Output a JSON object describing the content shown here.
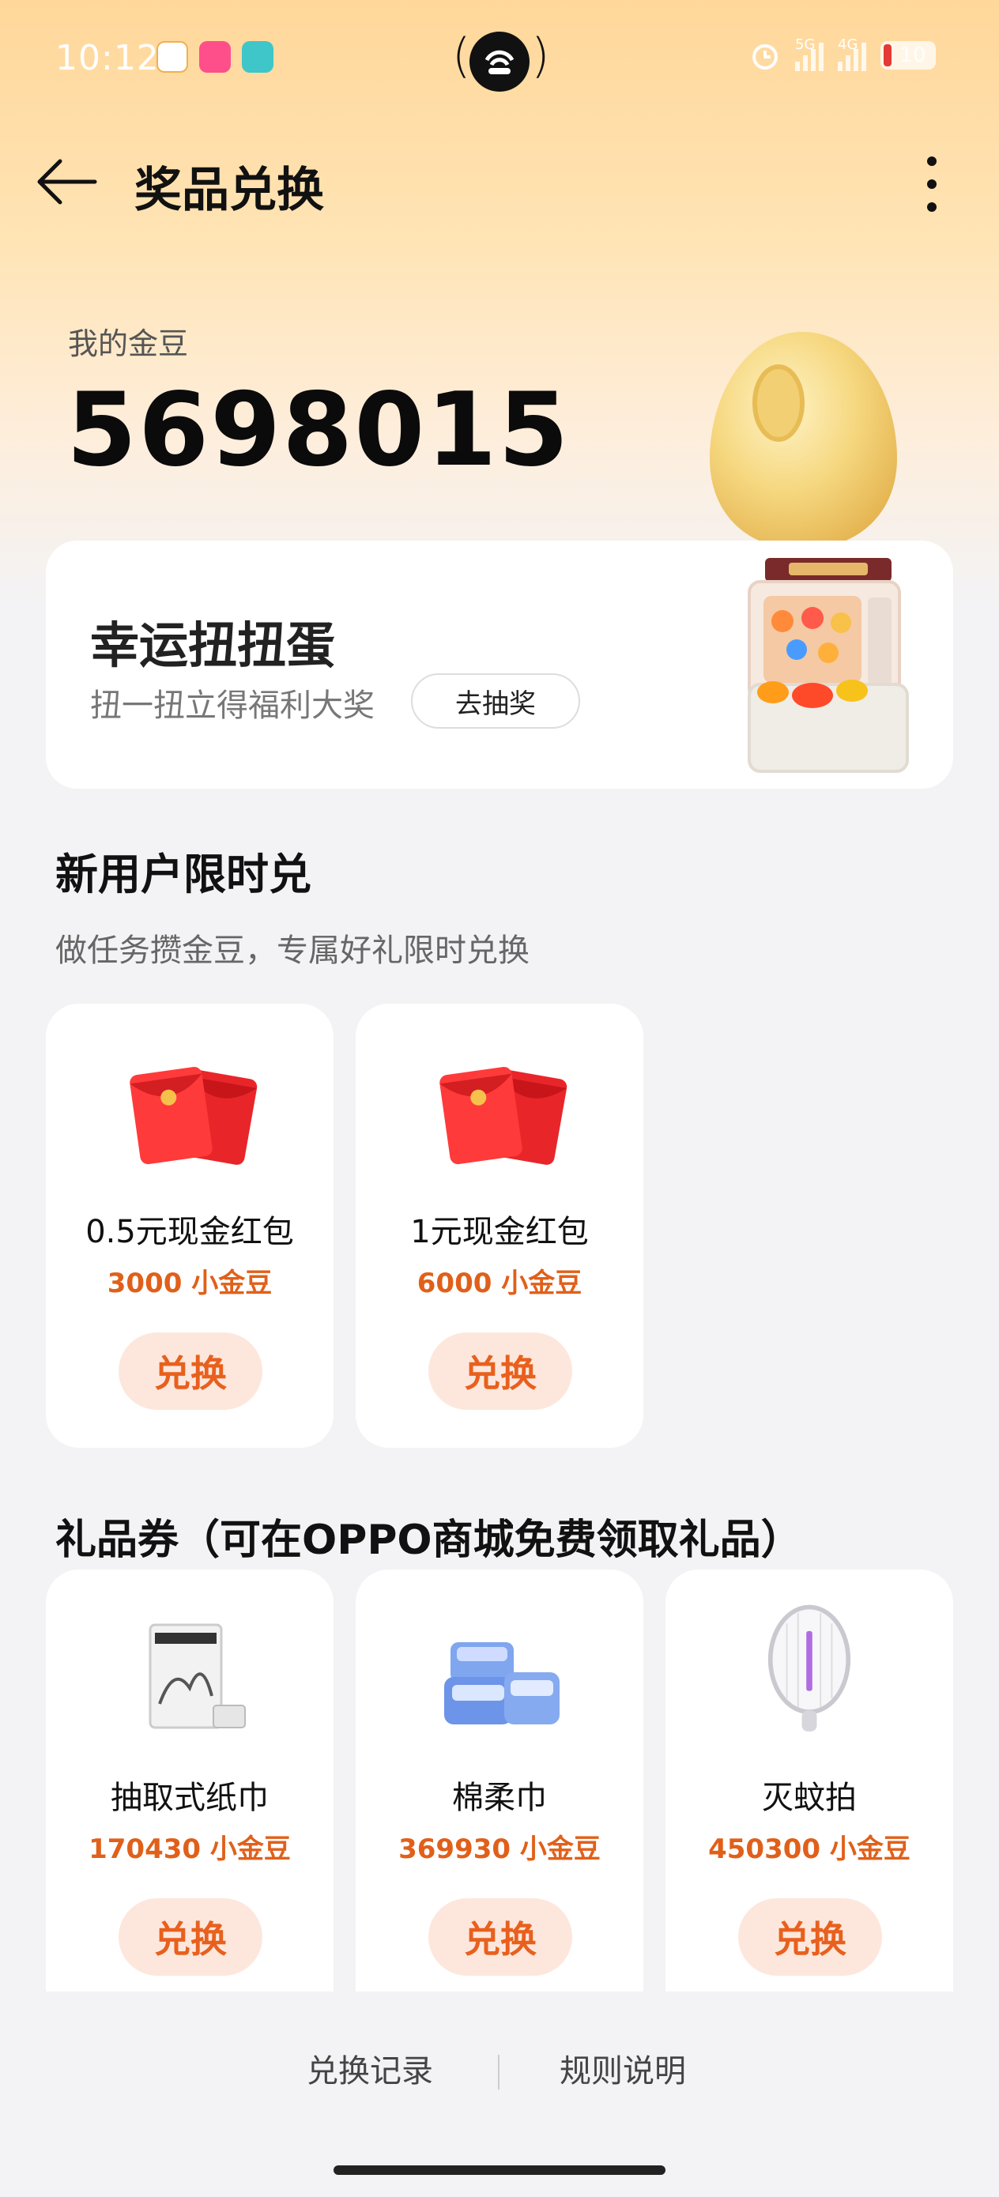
{
  "status_bar": {
    "time": "10:12",
    "network_1": "5G",
    "network_2": "4G",
    "battery": "10"
  },
  "header": {
    "title": "奖品兑换"
  },
  "beans": {
    "label": "我的金豆",
    "value": "5698015"
  },
  "lucky": {
    "title": "幸运扭扭蛋",
    "subtitle": "扭一扭立得福利大奖",
    "button": "去抽奖"
  },
  "new_user": {
    "title": "新用户限时兑",
    "subtitle": "做任务攒金豆，专属好礼限时兑换",
    "items": [
      {
        "name": "0.5元现金红包",
        "price": "3000 小金豆",
        "button": "兑换",
        "icon": "red-envelope-icon"
      },
      {
        "name": "1元现金红包",
        "price": "6000 小金豆",
        "button": "兑换",
        "icon": "red-envelope-icon"
      }
    ]
  },
  "gifts": {
    "title": "礼品券（可在OPPO商城免费领取礼品）",
    "items": [
      {
        "name": "抽取式纸巾",
        "price": "170430 小金豆",
        "button": "兑换",
        "icon": "tissue-box-icon"
      },
      {
        "name": "棉柔巾",
        "price": "369930 小金豆",
        "button": "兑换",
        "icon": "cotton-towel-icon"
      },
      {
        "name": "灭蚊拍",
        "price": "450300 小金豆",
        "button": "兑换",
        "icon": "mosquito-swatter-icon"
      }
    ]
  },
  "footer": {
    "records": "兑换记录",
    "rules": "规则说明"
  },
  "colors": {
    "accent": "#e8601e",
    "button_bg": "#fde7dc",
    "header_gradient_top": "#ffd79a"
  }
}
